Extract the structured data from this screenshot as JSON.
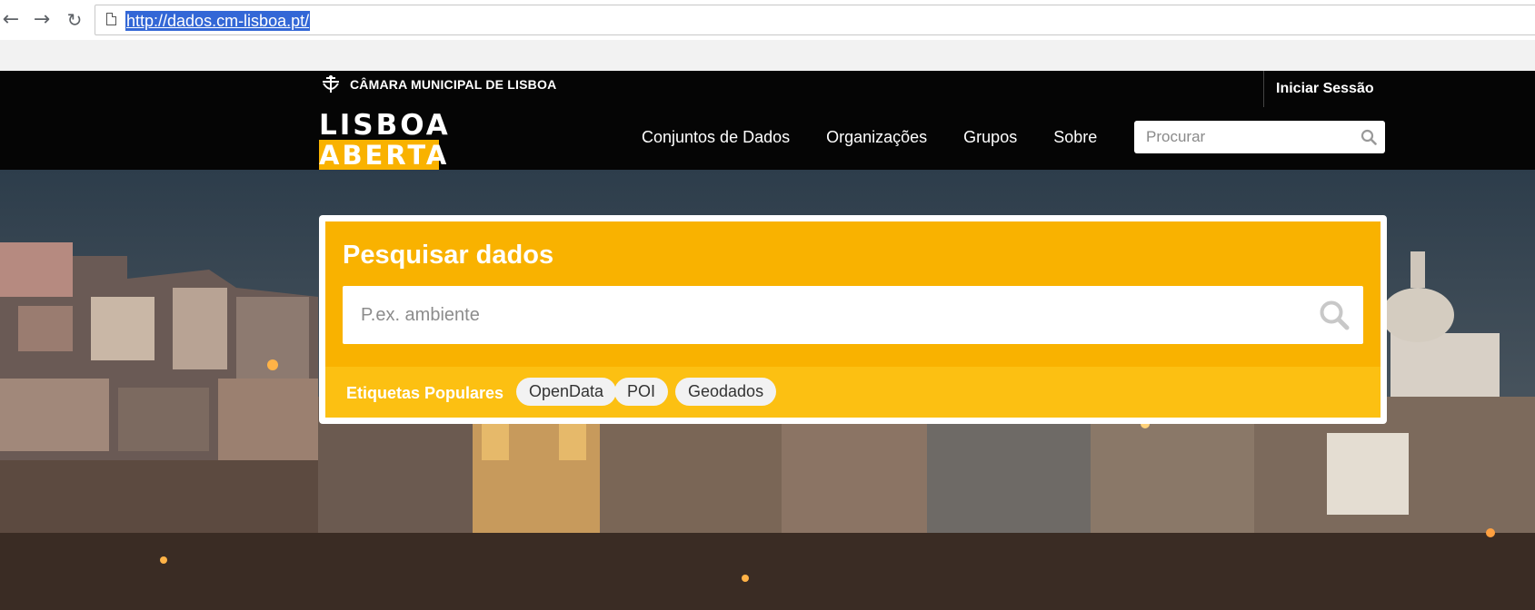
{
  "browser": {
    "url": "http://dados.cm-lisboa.pt/",
    "back_icon": "arrow-left-icon",
    "forward_icon": "arrow-right-icon",
    "reload_icon": "reload-icon"
  },
  "header": {
    "municipality": "CÂMARA MUNICIPAL DE LISBOA",
    "login": "Iniciar Sessão",
    "brand_top": "LISBOA",
    "brand_bottom": "ABERTA",
    "nav": [
      "Conjuntos de Dados",
      "Organizações",
      "Grupos",
      "Sobre"
    ],
    "search_placeholder": "Procurar"
  },
  "hero": {
    "title": "Pesquisar dados",
    "search_placeholder": "P.ex. ambiente",
    "tags_label": "Etiquetas Populares",
    "tags": [
      "OpenData",
      "POI",
      "Geodados"
    ]
  },
  "colors": {
    "accent": "#f9b200",
    "header_bg": "#050505"
  }
}
